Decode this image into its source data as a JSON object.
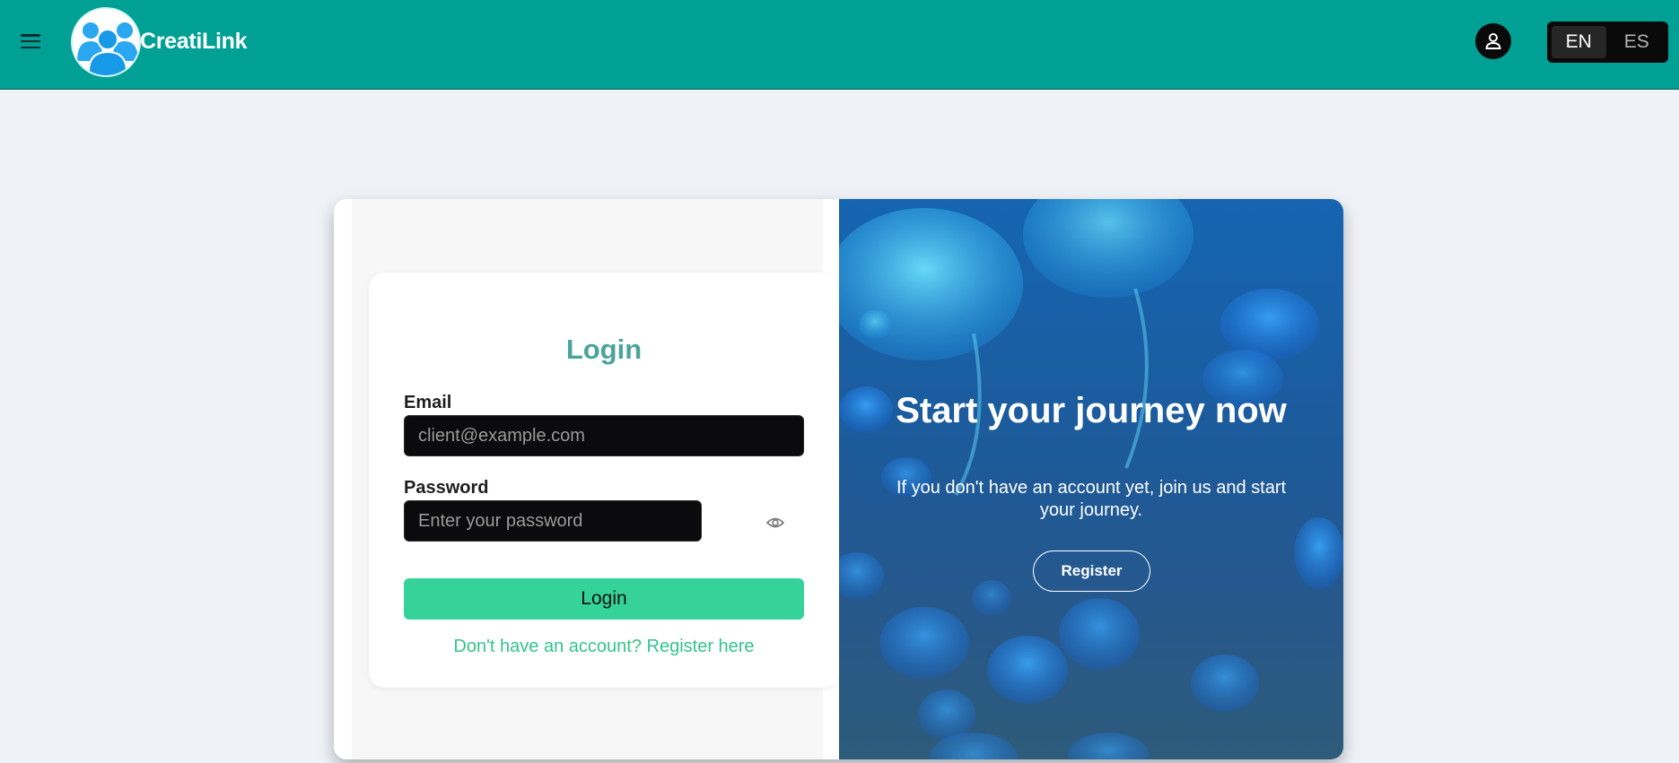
{
  "header": {
    "brand": "CreatiLink",
    "icons": {
      "menu": "menu-icon",
      "logo": "people-group-logo",
      "user": "user-icon"
    },
    "languages": [
      {
        "label": "EN",
        "active": true
      },
      {
        "label": "ES",
        "active": false
      }
    ]
  },
  "login": {
    "title": "Login",
    "email_label": "Email",
    "email_placeholder": "client@example.com",
    "password_label": "Password",
    "password_placeholder": "Enter your password",
    "submit_label": "Login",
    "register_link": "Don't have an account? Register here",
    "password_toggle_icon": "eye-icon"
  },
  "promo": {
    "title": "Start your journey now",
    "text": "If you don't have an account yet, join us and start your journey.",
    "button_label": "Register",
    "background": "jellyfish-photo"
  },
  "colors": {
    "header_bg": "#00a094",
    "title_teal": "#4aa49c",
    "button_green": "#35d399",
    "link_green": "#35c48b",
    "page_bg": "#eff2f7"
  }
}
